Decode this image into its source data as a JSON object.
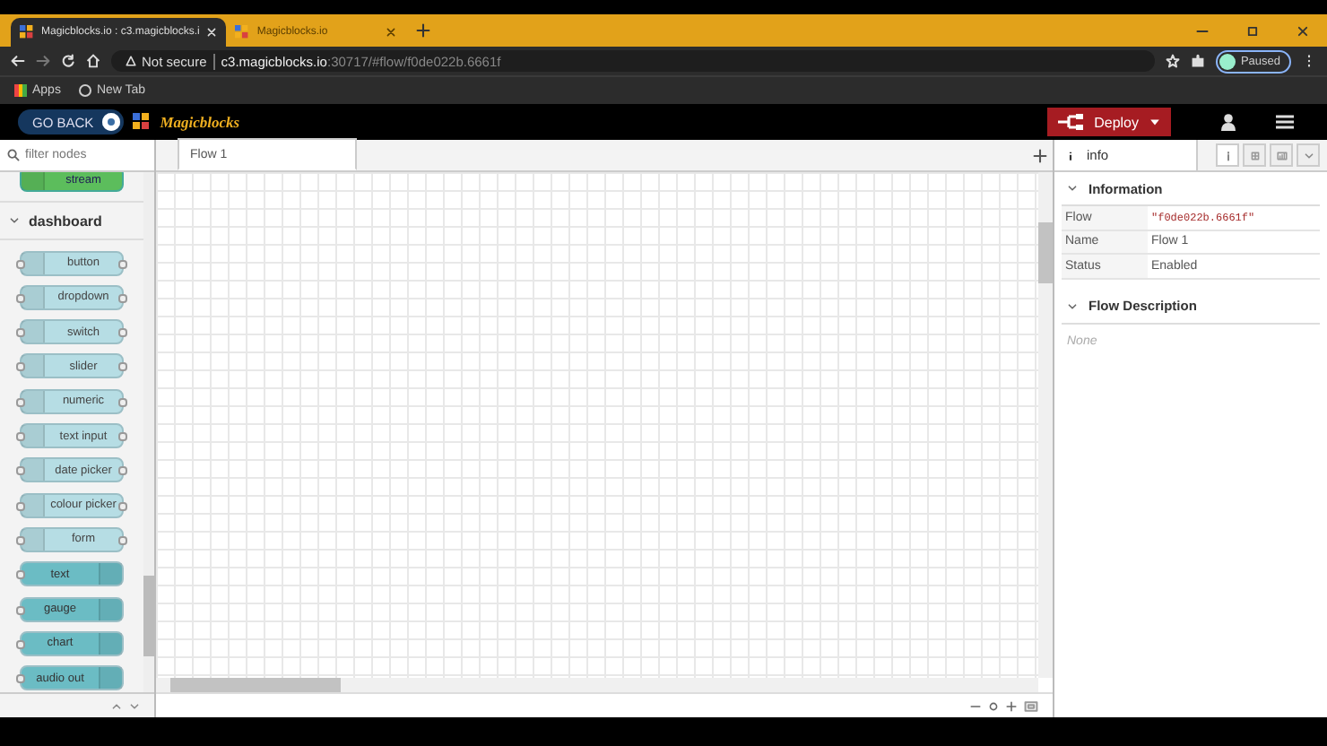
{
  "browser": {
    "tabs": [
      {
        "title": "Magicblocks.io : c3.magicblocks.i",
        "selected": true
      },
      {
        "title": "Magicblocks.io",
        "selected": false
      }
    ],
    "address": {
      "security": "Not secure",
      "host": "c3.magicblocks.io",
      "path": ":30717/#flow/f0de022b.6661f"
    },
    "profile": "Paused",
    "bookmarks": [
      "Apps",
      "New Tab"
    ]
  },
  "header": {
    "go_back": "GO BACK",
    "logo": "Magicblocks",
    "deploy": "Deploy"
  },
  "palette": {
    "placeholder": "filter nodes",
    "partial_node": "stream",
    "category": {
      "label": "dashboard",
      "expanded": true
    },
    "nodes": [
      {
        "label": "button",
        "kind": "input"
      },
      {
        "label": "dropdown",
        "kind": "input"
      },
      {
        "label": "switch",
        "kind": "input"
      },
      {
        "label": "slider",
        "kind": "input"
      },
      {
        "label": "numeric",
        "kind": "input"
      },
      {
        "label": "text input",
        "kind": "input"
      },
      {
        "label": "date picker",
        "kind": "input"
      },
      {
        "label": "colour picker",
        "kind": "input"
      },
      {
        "label": "form",
        "kind": "input"
      },
      {
        "label": "text",
        "kind": "output"
      },
      {
        "label": "gauge",
        "kind": "output"
      },
      {
        "label": "chart",
        "kind": "output"
      },
      {
        "label": "audio out",
        "kind": "output"
      }
    ]
  },
  "workspace": {
    "tabs": [
      {
        "label": "Flow 1",
        "selected": true
      }
    ]
  },
  "sidebar": {
    "tab": "info",
    "sections": [
      {
        "title": "Information",
        "expanded": true,
        "rows": [
          {
            "key": "Flow",
            "value": "\"f0de022b.6661f\"",
            "kind": "code"
          },
          {
            "key": "Name",
            "value": "Flow 1",
            "kind": "text"
          },
          {
            "key": "Status",
            "value": "Enabled",
            "kind": "text"
          }
        ]
      },
      {
        "title": "Flow Description",
        "expanded": true,
        "text": "None"
      }
    ]
  }
}
